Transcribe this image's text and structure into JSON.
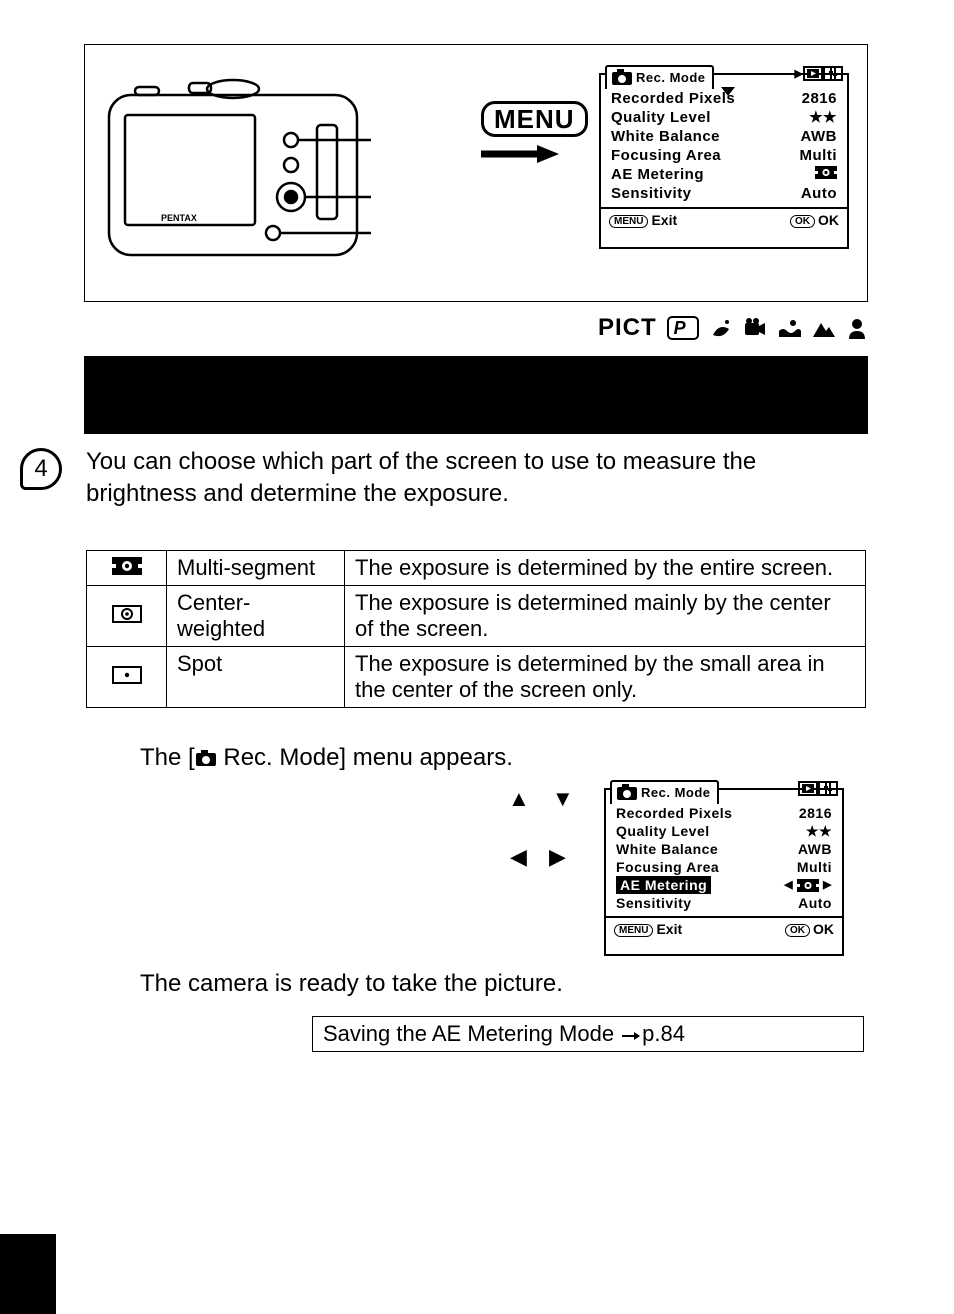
{
  "chapter": "4",
  "menu_button_label": "MENU",
  "lcd_menu": {
    "title": "Rec. Mode",
    "items": [
      {
        "label": "Recorded Pixels",
        "value": "2816"
      },
      {
        "label": "Quality Level",
        "value": "★★"
      },
      {
        "label": "White Balance",
        "value": "AWB"
      },
      {
        "label": "Focusing Area",
        "value": "Multi"
      },
      {
        "label": "AE Metering",
        "value_icon": "multi-segment"
      },
      {
        "label": "Sensitivity",
        "value": "Auto"
      }
    ],
    "foot_left_chip": "MENU",
    "foot_left": "Exit",
    "foot_right_chip": "OK",
    "foot_right": "OK"
  },
  "mode_row_label": "PICT",
  "mode_row_p": "P",
  "intro": "You can choose which part of the screen to use to measure the brightness and determine the exposure.",
  "metering_table": [
    {
      "icon": "multi-segment",
      "name": "Multi-segment",
      "desc": "The exposure is determined by the entire screen."
    },
    {
      "icon": "center-weighted",
      "name": "Center-weighted",
      "desc": "The exposure is determined mainly by the center of the screen."
    },
    {
      "icon": "spot",
      "name": "Spot",
      "desc": "The exposure is determined by the small area in the center of the screen only."
    }
  ],
  "step_rec_mode_pre": "The [",
  "step_rec_mode_post": " Rec. Mode] menu appears.",
  "step_ready": "The camera is ready to take the picture.",
  "save_box_text": "Saving the AE Metering Mode ",
  "save_box_page": "p.84"
}
